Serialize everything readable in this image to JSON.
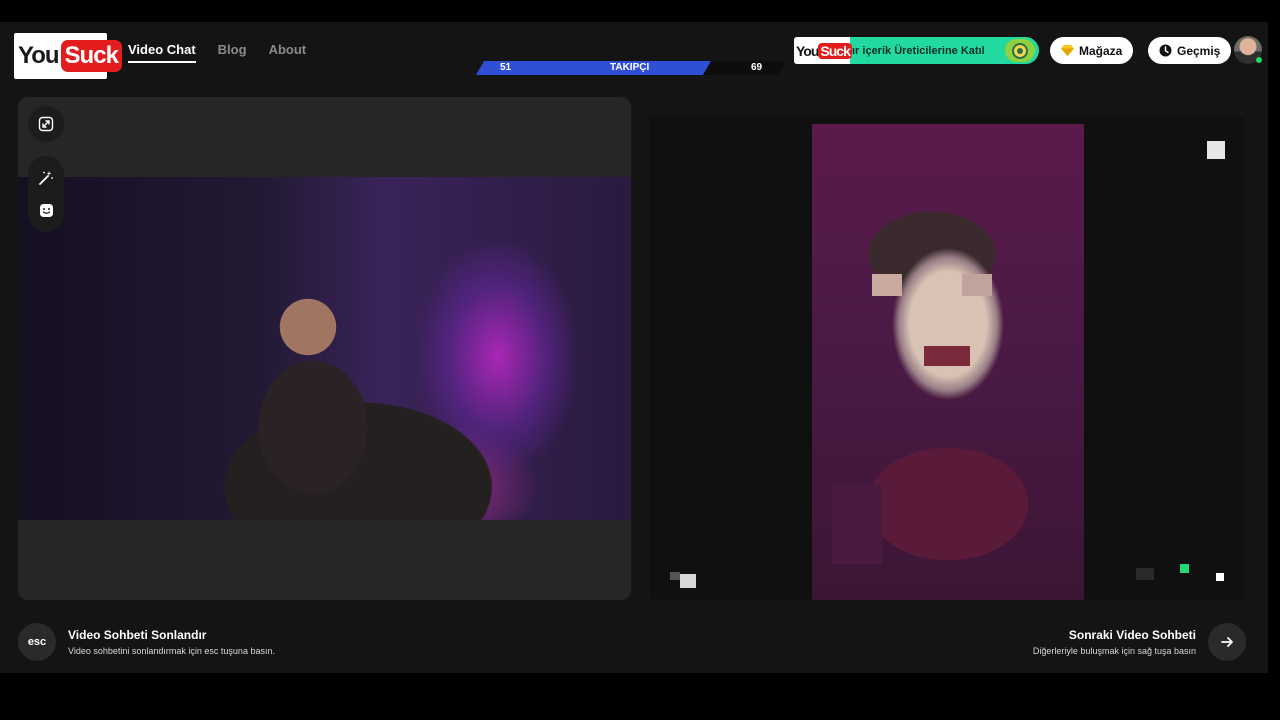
{
  "brand": {
    "logo_left": "You",
    "logo_right": "Suck"
  },
  "nav": {
    "items": [
      {
        "label": "Video Chat",
        "active": true
      },
      {
        "label": "Blog",
        "active": false
      },
      {
        "label": "About",
        "active": false
      }
    ]
  },
  "follower_bar": {
    "left_value": "51",
    "label": "TAKIPÇI",
    "right_value": "69"
  },
  "promo": {
    "logo_left": "You",
    "logo_right": "Suck",
    "text": "ır içerik Üreticilerine Katıl"
  },
  "header_buttons": {
    "store_label": "Mağaza",
    "history_label": "Geçmiş"
  },
  "footer": {
    "end_key": "esc",
    "end_title": "Video Sohbeti Sonlandır",
    "end_subtitle": "Video sohbetini sonlandırmak için esc tuşuna basın.",
    "next_title": "Sonraki Video Sohbeti",
    "next_subtitle": "Diğerleriyle buluşmak için sağ tuşa basın"
  },
  "colors": {
    "accent_green": "#22d9a0",
    "brand_red": "#e31d1d",
    "follow_blue": "#2f4fd6"
  },
  "icons": [
    "expand-icon",
    "magic-wand-icon",
    "sticker-icon",
    "diamond-icon",
    "clock-icon",
    "arrow-right-icon"
  ]
}
